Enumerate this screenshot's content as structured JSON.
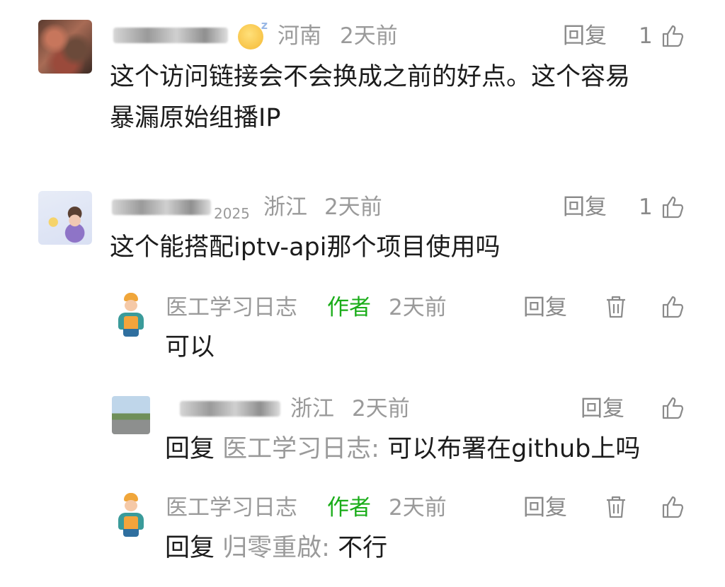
{
  "comments": [
    {
      "location": "河南",
      "time": "2天前",
      "reply_label": "回复",
      "likes": "1",
      "text_line1": "这个访问链接会不会换成之前的好点。这个容易",
      "text_line2": "暴漏原始组播IP"
    },
    {
      "name_suffix": "2025",
      "location": "浙江",
      "time": "2天前",
      "reply_label": "回复",
      "likes": "1",
      "text": "这个能搭配iptv-api那个项目使用吗"
    }
  ],
  "replies": [
    {
      "name": "医工学习日志",
      "badge": "作者",
      "time": "2天前",
      "reply_label": "回复",
      "text": "可以"
    },
    {
      "location": "浙江",
      "time": "2天前",
      "reply_label": "回复",
      "prefix": "回复",
      "target": "医工学习日志:",
      "text": "可以布署在github上吗"
    },
    {
      "name": "医工学习日志",
      "badge": "作者",
      "time": "2天前",
      "reply_label": "回复",
      "prefix": "回复",
      "target": "归零重啟:",
      "text": "不行"
    }
  ]
}
